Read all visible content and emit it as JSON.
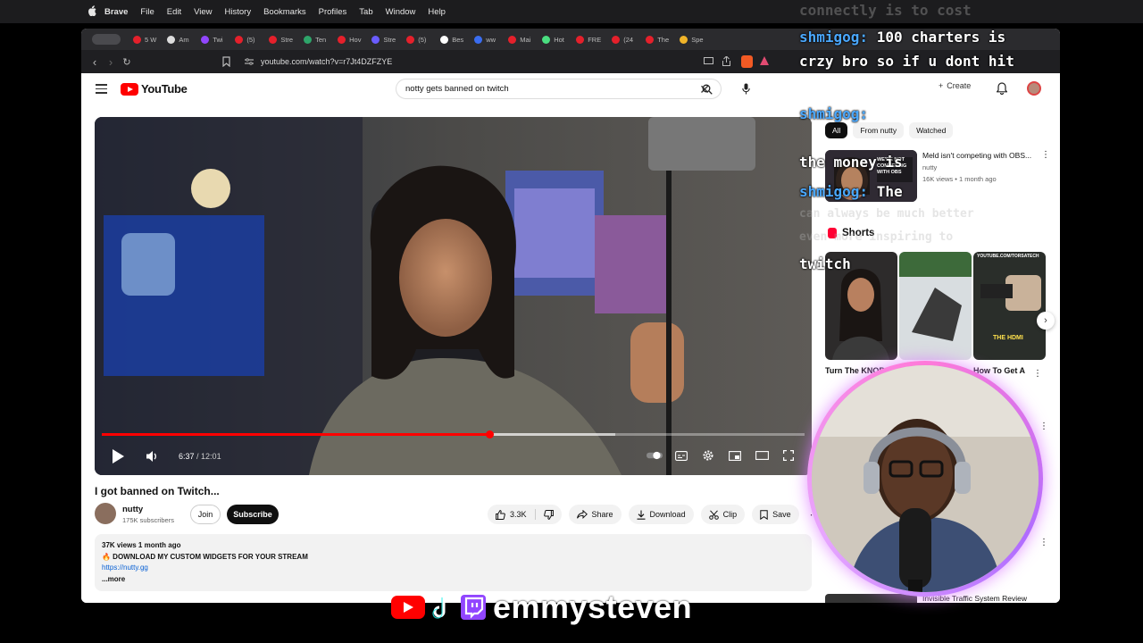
{
  "menubar": {
    "items": [
      "Brave",
      "File",
      "Edit",
      "View",
      "History",
      "Bookmarks",
      "Profiles",
      "Tab",
      "Window",
      "Help"
    ]
  },
  "tabs": [
    "5 W",
    "Am",
    "Twi",
    "(5)",
    "Stre",
    "Ten",
    "Hov",
    "Stre",
    "(5)",
    "Bes",
    "ww",
    "Mai",
    "Hot",
    "FRE",
    "(24",
    "The",
    "Spe"
  ],
  "address": {
    "url": "youtube.com/watch?v=r7Jt4DZFZYE"
  },
  "youtube": {
    "logo_text": "YouTube",
    "search_query": "notty gets banned on twitch",
    "create_label": "Create"
  },
  "player": {
    "time_current": "6:37",
    "time_total": "12:01",
    "progress_fraction": 0.551,
    "loaded_fraction": 0.73
  },
  "video": {
    "title": "I got banned on Twitch...",
    "channel": "nutty",
    "subscribers": "175K subscribers",
    "join_label": "Join",
    "subscribe_label": "Subscribe",
    "likes": "3.3K",
    "share_label": "Share",
    "download_label": "Download",
    "clip_label": "Clip",
    "save_label": "Save"
  },
  "description": {
    "stats": "37K views  1 month ago",
    "line1": "🔥 DOWNLOAD MY CUSTOM WIDGETS FOR YOUR STREAM",
    "link": "https://nutty.gg",
    "more": "...more"
  },
  "sidebar": {
    "chips": [
      "All",
      "From nutty",
      "Watched"
    ],
    "rec": {
      "title": "Meld isn't competing with OBS...",
      "channel": "nutty",
      "meta": "16K views • 1 month ago",
      "thumb_text": "WE'RE NOT COMPETING WITH OBS"
    },
    "shorts_heading": "Shorts",
    "shorts": [
      {
        "caption": "Turn The KNOB"
      },
      {
        "caption": ""
      },
      {
        "caption": "How To Get A"
      }
    ],
    "short_overlay_text": "THE HDMI",
    "short_channel_text": "YOUTUBE.COM/TORSATECH",
    "bottom_title": "Invisible Traffic System Review"
  },
  "chat": {
    "faded_top": "connectly is to cost",
    "lines": [
      {
        "user": "shmigog:",
        "text": " 100 charters is"
      },
      {
        "user": "",
        "text": "crzy bro so if u dont hit"
      },
      {
        "user": "shmigog:",
        "text": ""
      },
      {
        "user": "",
        "text": "the money is"
      },
      {
        "user": "shmigog:",
        "text": " The"
      },
      {
        "user": "",
        "text": "twitch"
      }
    ],
    "faded_right": [
      "can always be much better",
      "even more inspiring to"
    ]
  },
  "brand": {
    "name": "emmysteven"
  },
  "colors": {
    "accent_red": "#ff0000",
    "twitch_purple": "#9146ff",
    "chat_user": "#4aa8ff"
  }
}
